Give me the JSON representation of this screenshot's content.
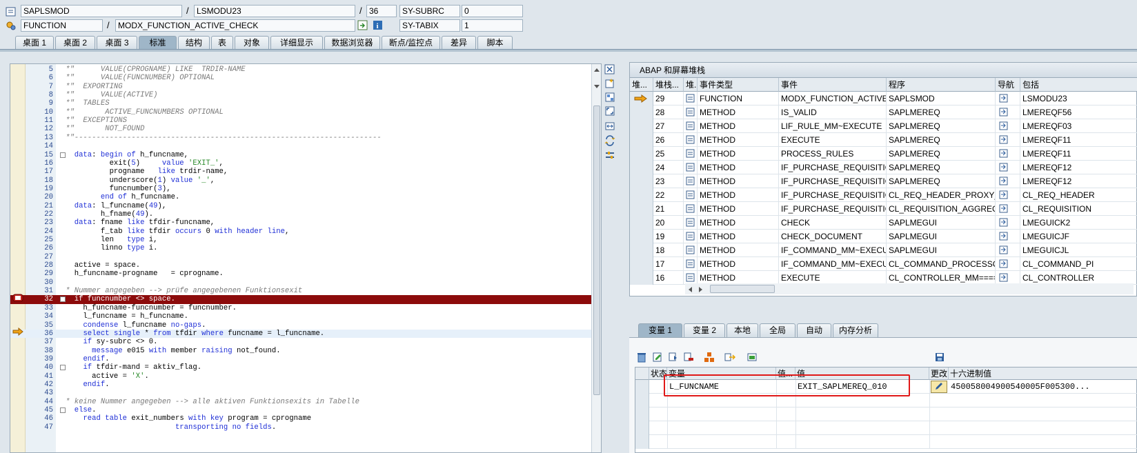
{
  "header": {
    "program": "SAPLSMOD",
    "include": "LSMODU23",
    "line": "36",
    "subrc_label": "SY-SUBRC",
    "subrc_value": "0",
    "event_type": "FUNCTION",
    "event_name": "MODX_FUNCTION_ACTIVE_CHECK",
    "tabix_label": "SY-TABIX",
    "tabix_value": "1",
    "sep": "/"
  },
  "tabs": [
    "桌面 1",
    "桌面 2",
    "桌面 3",
    "标准",
    "结构",
    "表",
    "对象",
    "详细显示",
    "数据浏览器",
    "断点/监控点",
    "差异",
    "脚本"
  ],
  "active_tab": 3,
  "code_lines": [
    {
      "n": "5",
      "t": "*\"      VALUE(CPROGNAME) LIKE  TRDIR-NAME",
      "c": "cm"
    },
    {
      "n": "6",
      "t": "*\"      VALUE(FUNCNUMBER) OPTIONAL",
      "c": "cm"
    },
    {
      "n": "7",
      "t": "*\"  EXPORTING",
      "c": "cm"
    },
    {
      "n": "8",
      "t": "*\"      VALUE(ACTIVE)",
      "c": "cm"
    },
    {
      "n": "9",
      "t": "*\"  TABLES",
      "c": "cm"
    },
    {
      "n": "10",
      "t": "*\"       ACTIVE_FUNCNUMBERS OPTIONAL",
      "c": "cm"
    },
    {
      "n": "11",
      "t": "*\"  EXCEPTIONS",
      "c": "cm"
    },
    {
      "n": "12",
      "t": "*\"       NOT_FOUND",
      "c": "cm"
    },
    {
      "n": "13",
      "t": "*\"----------------------------------------------------------------------",
      "c": "cm"
    },
    {
      "n": "14",
      "t": "",
      "c": ""
    },
    {
      "n": "15",
      "t": "  data: begin of h_funcname,",
      "c": ""
    },
    {
      "n": "16",
      "t": "          exit(5)     value 'EXIT_',",
      "c": ""
    },
    {
      "n": "17",
      "t": "          progname   like trdir-name,",
      "c": ""
    },
    {
      "n": "18",
      "t": "          underscore(1) value '_',",
      "c": ""
    },
    {
      "n": "19",
      "t": "          funcnumber(3),",
      "c": ""
    },
    {
      "n": "20",
      "t": "        end of h_funcname.",
      "c": ""
    },
    {
      "n": "21",
      "t": "  data: l_funcname(49),",
      "c": ""
    },
    {
      "n": "22",
      "t": "        h_fname(49).",
      "c": ""
    },
    {
      "n": "23",
      "t": "  data: fname like tfdir-funcname,",
      "c": ""
    },
    {
      "n": "24",
      "t": "        f_tab like tfdir occurs 0 with header line,",
      "c": ""
    },
    {
      "n": "25",
      "t": "        len   type i,",
      "c": ""
    },
    {
      "n": "26",
      "t": "        linno type i.",
      "c": ""
    },
    {
      "n": "27",
      "t": "",
      "c": ""
    },
    {
      "n": "28",
      "t": "  active = space.",
      "c": ""
    },
    {
      "n": "29",
      "t": "  h_funcname-progname   = cprogname.",
      "c": ""
    },
    {
      "n": "30",
      "t": "",
      "c": ""
    },
    {
      "n": "31",
      "t": "* Nummer angegeben --> prüfe angegebenen Funktionsexit",
      "c": "cm"
    },
    {
      "n": "32",
      "t": "  if funcnumber <> space.",
      "c": "bp"
    },
    {
      "n": "33",
      "t": "    h_funcname-funcnumber = funcnumber.",
      "c": ""
    },
    {
      "n": "34",
      "t": "    l_funcname = h_funcname.",
      "c": ""
    },
    {
      "n": "35",
      "t": "    condense l_funcname no-gaps.",
      "c": ""
    },
    {
      "n": "36",
      "t": "    select single * from tfdir where funcname = l_funcname.",
      "c": "cur"
    },
    {
      "n": "37",
      "t": "    if sy-subrc <> 0.",
      "c": ""
    },
    {
      "n": "38",
      "t": "      message e015 with member raising not_found.",
      "c": ""
    },
    {
      "n": "39",
      "t": "    endif.",
      "c": ""
    },
    {
      "n": "40",
      "t": "    if tfdir-mand = aktiv_flag.",
      "c": ""
    },
    {
      "n": "41",
      "t": "      active = 'X'.",
      "c": ""
    },
    {
      "n": "42",
      "t": "    endif.",
      "c": ""
    },
    {
      "n": "43",
      "t": "",
      "c": ""
    },
    {
      "n": "44",
      "t": "* keine Nummer angegeben --> alle aktiven Funktionsexits in Tabelle",
      "c": "cm"
    },
    {
      "n": "45",
      "t": "  else.",
      "c": ""
    },
    {
      "n": "46",
      "t": "    read table exit_numbers with key program = cprogname",
      "c": ""
    },
    {
      "n": "47",
      "t": "                         transporting no fields.",
      "c": ""
    }
  ],
  "stack": {
    "title": "ABAP 和屏幕堆栈",
    "columns": [
      "堆...",
      "堆栈...",
      "堆...",
      "事件类型",
      "事件",
      "程序",
      "导航",
      "包括"
    ],
    "rows": [
      {
        "level": "29",
        "type": "FUNCTION",
        "event": "MODX_FUNCTION_ACTIVE_...",
        "program": "SAPLSMOD",
        "include": "LSMODU23",
        "current": true
      },
      {
        "level": "28",
        "type": "METHOD",
        "event": "IS_VALID",
        "program": "SAPLMEREQ",
        "include": "LMEREQF56"
      },
      {
        "level": "27",
        "type": "METHOD",
        "event": "LIF_RULE_MM~EXECUTE",
        "program": "SAPLMEREQ",
        "include": "LMEREQF03"
      },
      {
        "level": "26",
        "type": "METHOD",
        "event": "EXECUTE",
        "program": "SAPLMEREQ",
        "include": "LMEREQF11"
      },
      {
        "level": "25",
        "type": "METHOD",
        "event": "PROCESS_RULES",
        "program": "SAPLMEREQ",
        "include": "LMEREQF11"
      },
      {
        "level": "24",
        "type": "METHOD",
        "event": "IF_PURCHASE_REQUISITION...",
        "program": "SAPLMEREQ",
        "include": "LMEREQF12"
      },
      {
        "level": "23",
        "type": "METHOD",
        "event": "IF_PURCHASE_REQUISITION...",
        "program": "SAPLMEREQ",
        "include": "LMEREQF12"
      },
      {
        "level": "22",
        "type": "METHOD",
        "event": "IF_PURCHASE_REQUISITION...",
        "program": "CL_REQ_HEADER_PROXY_M...",
        "include": "CL_REQ_HEADER"
      },
      {
        "level": "21",
        "type": "METHOD",
        "event": "IF_PURCHASE_REQUISITION...",
        "program": "CL_REQUISITION_AGGREGA...",
        "include": "CL_REQUISITION"
      },
      {
        "level": "20",
        "type": "METHOD",
        "event": "CHECK",
        "program": "SAPLMEGUI",
        "include": "LMEGUICK2"
      },
      {
        "level": "19",
        "type": "METHOD",
        "event": "CHECK_DOCUMENT",
        "program": "SAPLMEGUI",
        "include": "LMEGUICJF"
      },
      {
        "level": "18",
        "type": "METHOD",
        "event": "IF_COMMAND_MM~EXECUTE",
        "program": "SAPLMEGUI",
        "include": "LMEGUICJL"
      },
      {
        "level": "17",
        "type": "METHOD",
        "event": "IF_COMMAND_MM~EXECUTE",
        "program": "CL_COMMAND_PROCESSOR...",
        "include": "CL_COMMAND_PI"
      },
      {
        "level": "16",
        "type": "METHOD",
        "event": "EXECUTE",
        "program": "CL_CONTROLLER_MM====...",
        "include": "CL_CONTROLLER"
      }
    ]
  },
  "var_tabs": [
    "变量 1",
    "变量 2",
    "本地",
    "全局",
    "自动",
    "内存分析"
  ],
  "var_active": 0,
  "vars": {
    "columns": [
      "状态",
      "变量",
      "值...",
      "值",
      "更改",
      "十六进制值"
    ],
    "rows": [
      {
        "name": "L_FUNCNAME",
        "value": "EXIT_SAPLMEREQ_010",
        "hex": "450058004900540005F005300..."
      }
    ]
  },
  "colors": {
    "breakpoint_line": "#8c0b0b",
    "current_line": "#e6f0fa",
    "highlight_box": "#e01818",
    "tab_active": "#9fb6c8"
  }
}
